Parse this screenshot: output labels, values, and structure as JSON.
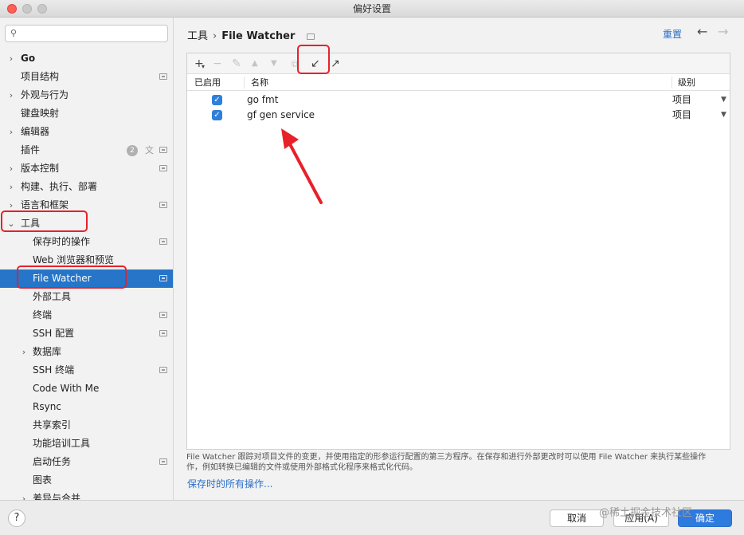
{
  "window": {
    "title": "偏好设置"
  },
  "sidebar": {
    "search_placeholder": "",
    "items": [
      {
        "label": "Go",
        "chevron": "›"
      },
      {
        "label": "项目结构"
      },
      {
        "label": "外观与行为",
        "chevron": "›"
      },
      {
        "label": "键盘映射"
      },
      {
        "label": "编辑器",
        "chevron": "›"
      },
      {
        "label": "插件",
        "badge": "2"
      },
      {
        "label": "版本控制",
        "chevron": "›"
      },
      {
        "label": "构建、执行、部署",
        "chevron": "›"
      },
      {
        "label": "语言和框架",
        "chevron": "›"
      },
      {
        "label": "工具",
        "chevron": "⌄"
      },
      {
        "label": "保存时的操作"
      },
      {
        "label": "Web 浏览器和预览"
      },
      {
        "label": "File Watcher"
      },
      {
        "label": "外部工具"
      },
      {
        "label": "终端"
      },
      {
        "label": "SSH 配置"
      },
      {
        "label": "数据库",
        "chevron": "›"
      },
      {
        "label": "SSH 终端"
      },
      {
        "label": "Code With Me"
      },
      {
        "label": "Rsync"
      },
      {
        "label": "共享索引"
      },
      {
        "label": "功能培训工具"
      },
      {
        "label": "启动任务"
      },
      {
        "label": "图表"
      },
      {
        "label": "差异与合并",
        "chevron": "›"
      }
    ]
  },
  "header": {
    "breadcrumb_parent": "工具",
    "breadcrumb_sep": "›",
    "breadcrumb_current": "File Watcher",
    "reset_label": "重置",
    "back_icon": "←",
    "forward_icon": "→"
  },
  "toolbar": {
    "add": "+",
    "add_arrow": "▾",
    "remove": "−",
    "edit": "✎",
    "up": "▲",
    "down": "▼",
    "copy": "⧉",
    "import": "↙",
    "export": "↗"
  },
  "table": {
    "columns": {
      "enabled": "已启用",
      "name": "名称",
      "level": "级别"
    },
    "rows": [
      {
        "checked": "✓",
        "name": "go fmt",
        "level": "项目",
        "caret": "▼"
      },
      {
        "checked": "✓",
        "name": "gf gen service",
        "level": "项目",
        "caret": "▼"
      }
    ]
  },
  "description": {
    "line1": "File Watcher 跟踪对项目文件的变更，并使用指定的形参运行配置的第三方程序。在保存和进行外部更改时可以使用 File Watcher 来执行某些操作",
    "line2": "作，例如转换已编辑的文件或使用外部格式化程序来格式化代码。",
    "link": "保存时的所有操作..."
  },
  "footer": {
    "help": "?",
    "cancel": "取消",
    "apply": "应用(A)",
    "ok": "确定",
    "watermark": "@稀土掘金技术社区"
  },
  "colors": {
    "selection": "#2675c9",
    "link": "#2a6fc9",
    "annotation": "#e8202a",
    "checkbox": "#2f80d8"
  }
}
